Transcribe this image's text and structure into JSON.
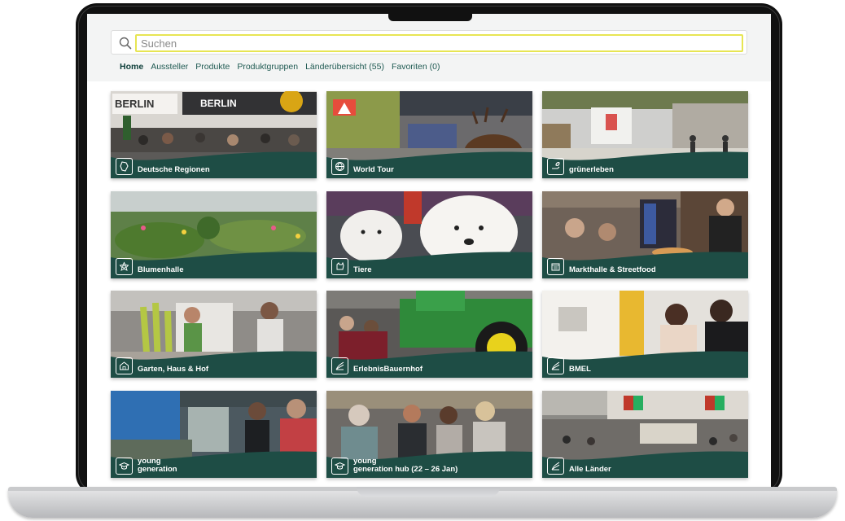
{
  "search": {
    "placeholder": "Suchen"
  },
  "nav": [
    {
      "label": "Home"
    },
    {
      "label": "Aussteller"
    },
    {
      "label": "Produkte"
    },
    {
      "label": "Produktgruppen"
    },
    {
      "label": "Länderübersicht (55)"
    },
    {
      "label": "Favoriten (0)"
    }
  ],
  "tiles": [
    {
      "label": "Deutsche Regionen",
      "icon": "regions-icon"
    },
    {
      "label": "World Tour",
      "icon": "globe-icon"
    },
    {
      "label": "grünerleben",
      "icon": "hand-leaf-icon"
    },
    {
      "label": "Blumenhalle",
      "icon": "flower-icon"
    },
    {
      "label": "Tiere",
      "icon": "animal-icon"
    },
    {
      "label": "Markthalle & Streetfood",
      "icon": "market-stall-icon"
    },
    {
      "label": "Garten, Haus & Hof",
      "icon": "house-icon"
    },
    {
      "label": "ErlebnisBauernhof",
      "icon": "farm-icon"
    },
    {
      "label": "BMEL",
      "icon": "ministry-icon"
    },
    {
      "label": "young\ngeneration",
      "line1": "young",
      "line2": "generation",
      "icon": "graduation-cap-icon"
    },
    {
      "label": "young\ngeneration hub (22 – 26 Jan)",
      "line1": "young",
      "line2": "generation hub (22 – 26 Jan)",
      "icon": "graduation-cap-icon"
    },
    {
      "label": "Alle Länder",
      "icon": "flag-icon"
    }
  ],
  "colors": {
    "brand_green": "#1e4d45",
    "search_focus": "#e7e553",
    "nav_text": "#1f5a52"
  }
}
